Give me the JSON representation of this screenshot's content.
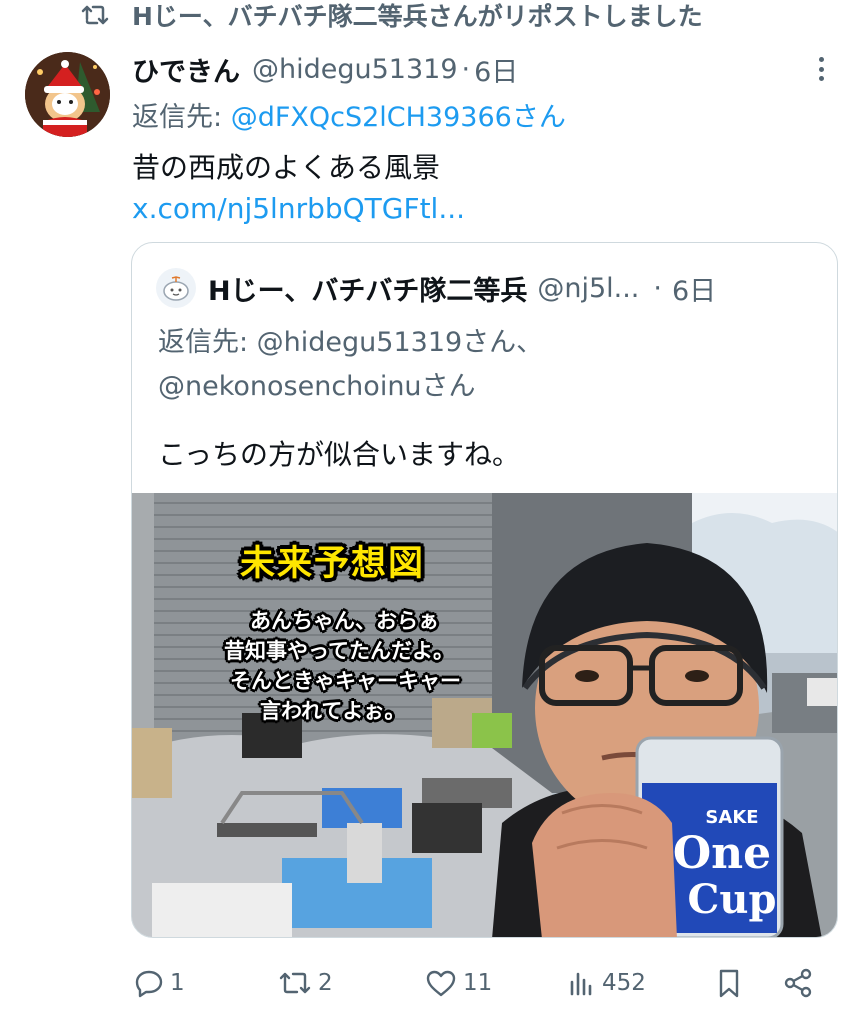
{
  "repost": {
    "text": "Hじー、バチバチ隊二等兵さんがリポストしました",
    "icon": "repost-icon"
  },
  "tweet": {
    "name": "ひできん",
    "handle": "@hidegu51319",
    "separator": "·",
    "time": "6日",
    "reply_prefix": "返信先: ",
    "reply_mention": "@dFXQcS2lCH39366さん",
    "body": "昔の西成のよくある風景",
    "link": "x.com/nj5lnrbbQTGFtl..."
  },
  "quote": {
    "name": "Hじー、バチバチ隊二等兵",
    "handle": "@nj5l...",
    "dot": "·",
    "time": "6日",
    "reply_line1": "返信先: @hidegu51319さん、",
    "reply_line2": "@nekonosenchoinuさん",
    "body": "こっちの方が似合いますね。",
    "image": {
      "title": "未来予想図",
      "lines": [
        "あんちゃん、おらぁ",
        "昔知事やってたんだよ。",
        "そんときゃキャーキャー",
        "言われてよぉ。"
      ],
      "bottle_top": "SAKE",
      "bottle_main": "One",
      "bottle_sub": "Cup"
    }
  },
  "actions": {
    "reply_count": "1",
    "repost_count": "2",
    "like_count": "11",
    "view_count": "452"
  },
  "colors": {
    "accent": "#1d9bf0",
    "secondary_text": "#536471",
    "primary_text": "#0f1419",
    "border": "#cfd9de",
    "overlay_title": "#ffe600"
  }
}
